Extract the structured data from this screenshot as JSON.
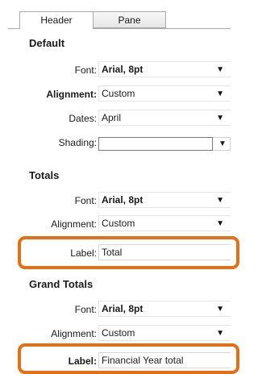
{
  "tabs": [
    "Header",
    "Pane"
  ],
  "sections": {
    "default": {
      "title": "Default",
      "font_label": "Font:",
      "font_value": "Arial, 8pt",
      "alignment_label": "Alignment:",
      "alignment_value": "Custom",
      "dates_label": "Dates:",
      "dates_value": "April",
      "shading_label": "Shading:"
    },
    "totals": {
      "title": "Totals",
      "font_label": "Font:",
      "font_value": "Arial, 8pt",
      "alignment_label": "Alignment:",
      "alignment_value": "Custom",
      "label_label": "Label:",
      "label_value": "Total"
    },
    "grand_totals": {
      "title": "Grand Totals",
      "font_label": "Font:",
      "font_value": "Arial, 8pt",
      "alignment_label": "Alignment:",
      "alignment_value": "Custom",
      "label_label": "Label:",
      "label_value": "Financial Year total"
    }
  },
  "icons": {
    "dropdown": "chevron-down-icon"
  },
  "colors": {
    "highlight": "#e36f17",
    "tab_border": "#a9a9a9"
  }
}
